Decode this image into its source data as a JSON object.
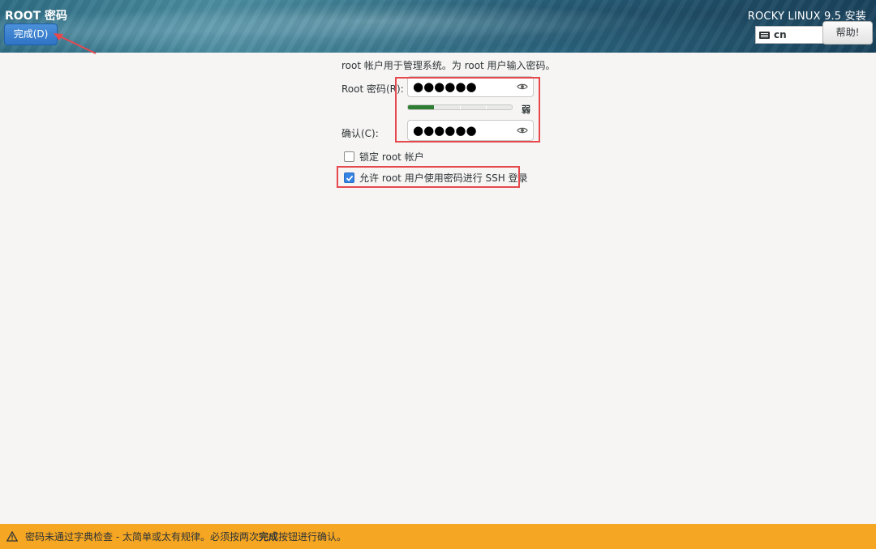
{
  "header": {
    "spoke_title": "ROOT 密码",
    "done_label": "完成(D)",
    "product_title": "ROCKY LINUX 9.5 安装",
    "keyboard_layout": "cn",
    "help_label": "帮助!"
  },
  "form": {
    "description": "root 帐户用于管理系统。为 root 用户输入密码。",
    "root_password_label": "Root 密码(R):",
    "root_password_value": "●●●●●●",
    "strength_level": 0.25,
    "strength_text": "弱",
    "confirm_label": "确认(C):",
    "confirm_value": "●●●●●●",
    "lock_root_label": "锁定 root 帐户",
    "lock_root_checked": false,
    "allow_ssh_label": "允许 root 用户使用密码进行 SSH 登录",
    "allow_ssh_checked": true
  },
  "status": {
    "message_prefix": "密码未通过字典检查 - 太简单或太有规律。必须按两次",
    "message_bold": "完成",
    "message_suffix": "按钮进行确认。"
  },
  "colors": {
    "done_button": "#3584e4",
    "strength_fill": "#2e7d32",
    "highlight": "#e5484d",
    "warning_bar": "#f5a623"
  }
}
